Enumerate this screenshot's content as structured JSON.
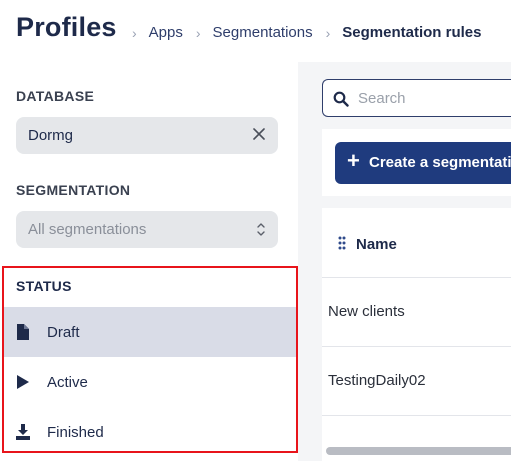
{
  "header": {
    "title": "Profiles",
    "breadcrumbs": [
      {
        "label": "Apps"
      },
      {
        "label": "Segmentations"
      },
      {
        "label": "Segmentation rules"
      }
    ]
  },
  "sidebar": {
    "database": {
      "label": "DATABASE",
      "value": "Dormg"
    },
    "segmentation": {
      "label": "SEGMENTATION",
      "placeholder": "All segmentations"
    },
    "status": {
      "label": "STATUS",
      "items": [
        {
          "label": "Draft",
          "icon": "file-icon",
          "selected": true
        },
        {
          "label": "Active",
          "icon": "play-icon",
          "selected": false
        },
        {
          "label": "Finished",
          "icon": "download-icon",
          "selected": false
        }
      ]
    }
  },
  "main": {
    "search": {
      "placeholder": "Search"
    },
    "create_button": {
      "label": "Create a segmentatio"
    },
    "table": {
      "columns": [
        {
          "label": "Name"
        }
      ],
      "rows": [
        {
          "name": "New clients"
        },
        {
          "name": "TestingDaily02"
        }
      ]
    }
  },
  "colors": {
    "primary": "#1f3b7e",
    "selected_row": "#d9dce7",
    "highlight_border": "#e8141b"
  }
}
